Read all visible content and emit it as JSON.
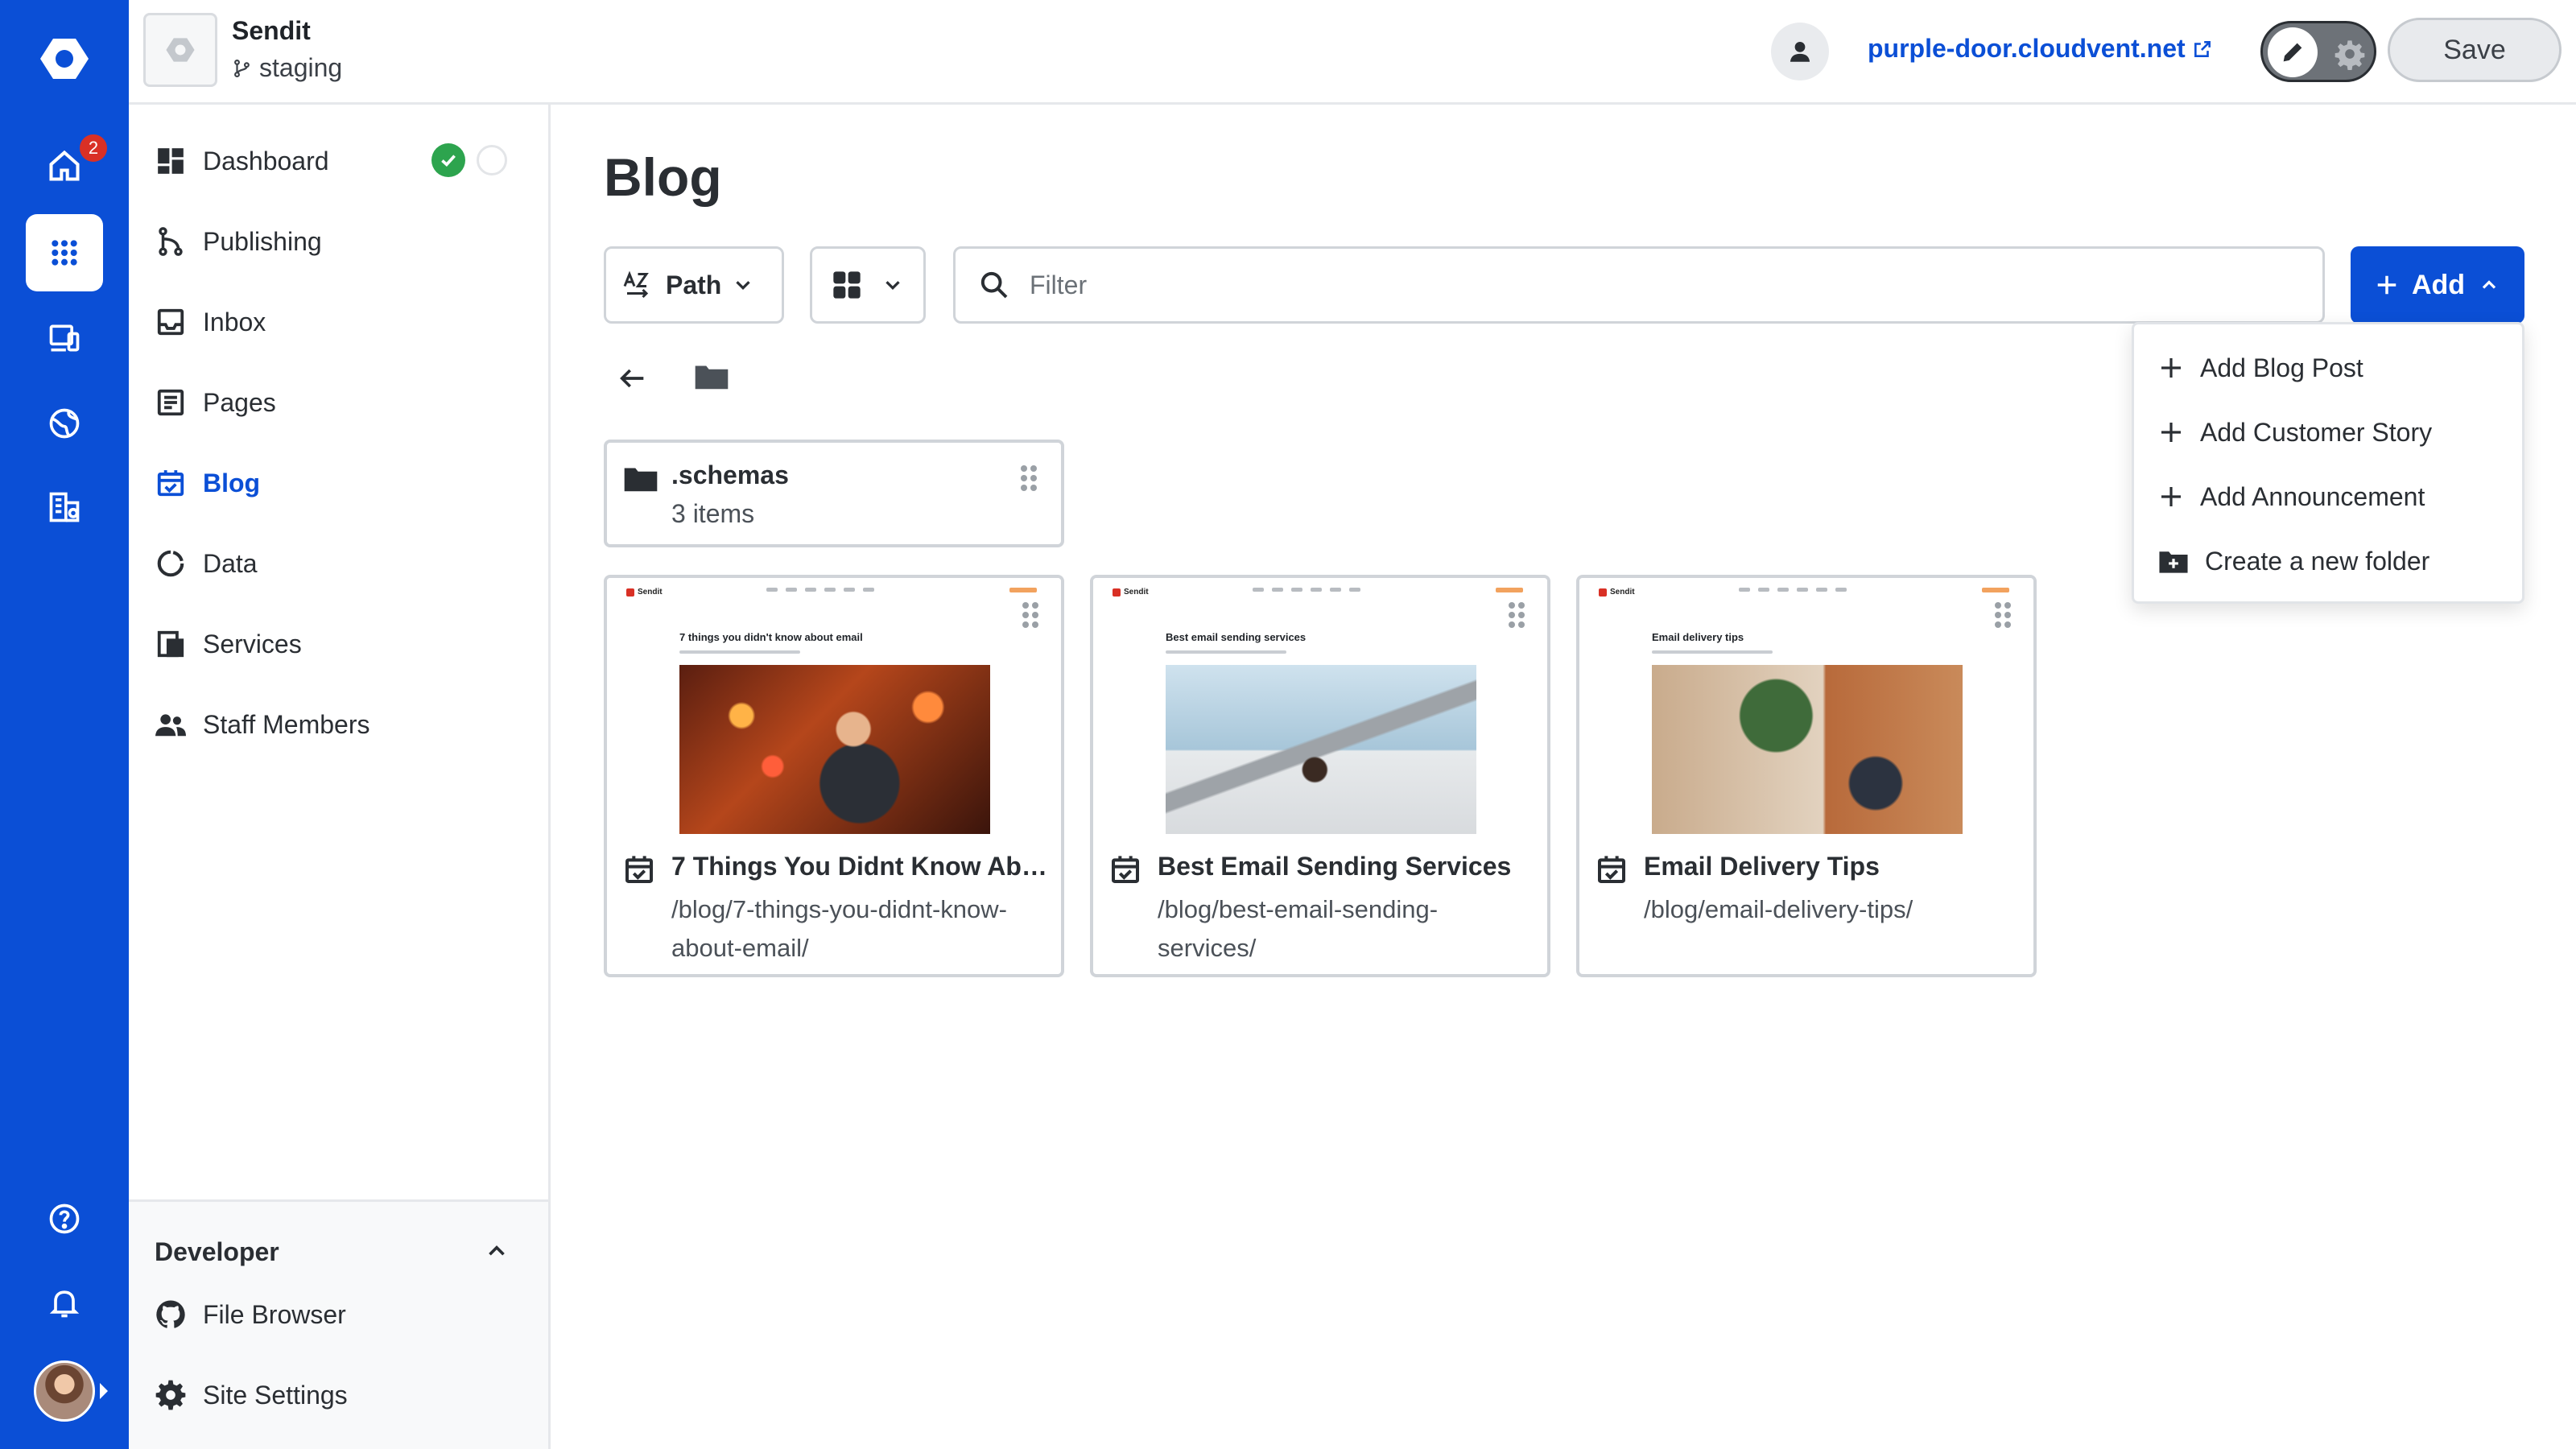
{
  "rail": {
    "notification_badge": "2",
    "icons": [
      "logo-icon",
      "home-icon",
      "apps-icon",
      "devices-icon",
      "globe-icon",
      "buildings-icon",
      "help-icon",
      "bell-icon"
    ],
    "accent_color": "#0b4fd6"
  },
  "header": {
    "site_name": "Sendit",
    "branch": "staging",
    "domain": "purple-door.cloudvent.net",
    "save_label": "Save"
  },
  "sidebar": {
    "items": [
      {
        "label": "Dashboard",
        "icon": "dashboard-icon"
      },
      {
        "label": "Publishing",
        "icon": "publishing-icon"
      },
      {
        "label": "Inbox",
        "icon": "inbox-icon"
      },
      {
        "label": "Pages",
        "icon": "pages-icon"
      },
      {
        "label": "Blog",
        "icon": "calendar-check-icon",
        "active": true
      },
      {
        "label": "Data",
        "icon": "data-icon"
      },
      {
        "label": "Services",
        "icon": "services-icon"
      },
      {
        "label": "Staff Members",
        "icon": "people-icon"
      }
    ],
    "developer": {
      "title": "Developer",
      "items": [
        {
          "label": "File Browser",
          "icon": "github-icon"
        },
        {
          "label": "Site Settings",
          "icon": "gear-icon"
        }
      ]
    }
  },
  "main": {
    "title": "Blog",
    "sort_label": "Path",
    "filter_placeholder": "Filter",
    "add_label": "Add",
    "add_menu": [
      {
        "label": "Add Blog Post",
        "icon": "plus-icon"
      },
      {
        "label": "Add Customer Story",
        "icon": "plus-icon"
      },
      {
        "label": "Add Announcement",
        "icon": "plus-icon"
      },
      {
        "label": "Create a new folder",
        "icon": "folder-plus-icon"
      }
    ],
    "folder": {
      "name": ".schemas",
      "count": "3 items"
    },
    "posts": [
      {
        "title": "7 Things You Didnt Know Abo...",
        "path": "/blog/7-things-you-didnt-know-about-email/",
        "preview_title": "7 things you didn't know about email",
        "preview_brand": "Sendit"
      },
      {
        "title": "Best Email Sending Services",
        "path": "/blog/best-email-sending-services/",
        "preview_title": "Best email sending services",
        "preview_brand": "Sendit"
      },
      {
        "title": "Email Delivery Tips",
        "path": "/blog/email-delivery-tips/",
        "preview_title": "Email delivery tips",
        "preview_brand": "Sendit"
      }
    ]
  }
}
